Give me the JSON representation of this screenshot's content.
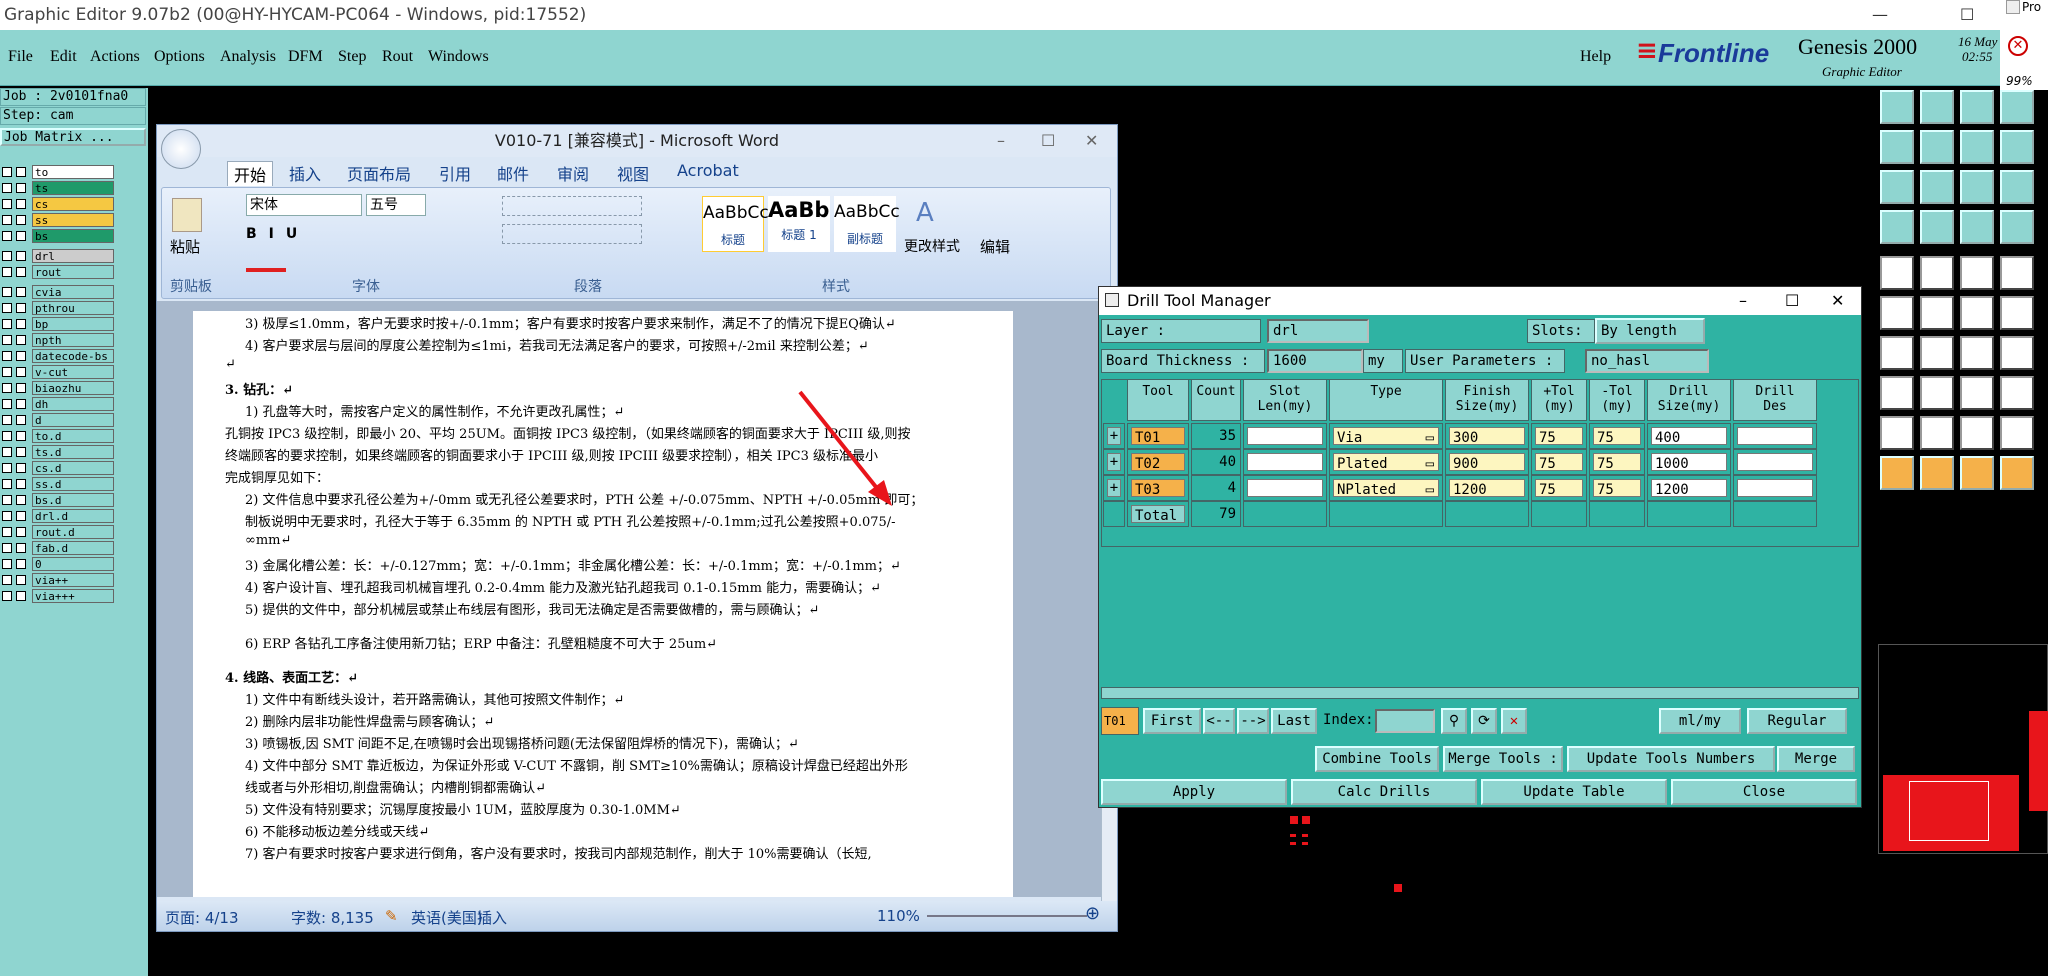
{
  "window": {
    "title": "Graphic Editor 9.07b2 (00@HY-HYCAM-PC064 - Windows, pid:17552)"
  },
  "menu": [
    "File",
    "Edit",
    "Actions",
    "Options",
    "Analysis",
    "DFM",
    "Step",
    "Rout",
    "Windows"
  ],
  "help": "Help",
  "brand": {
    "name": "Frontline",
    "product": "Genesis 2000",
    "sub": "Graphic Editor",
    "date": "16 May",
    "time": "02:55"
  },
  "side_right": {
    "label": "Pro",
    "pct": "99%"
  },
  "job": {
    "job_label": "Job : 2v0101fna0",
    "step_label": "Step: cam",
    "matrix_btn": "Job Matrix ..."
  },
  "layers": [
    {
      "name": "to",
      "color": "#ffffff"
    },
    {
      "name": "ts",
      "color": "#1f9a6a"
    },
    {
      "name": "cs",
      "color": "#f5c842"
    },
    {
      "name": "ss",
      "color": "#f5c842"
    },
    {
      "name": "bs",
      "color": "#1f9a6a"
    },
    {
      "name": "drl",
      "color": "#cccccc"
    },
    {
      "name": "rout",
      "color": "#8fd5d0"
    },
    {
      "name": "cvia",
      "color": "#8fd5d0"
    },
    {
      "name": "pthrou",
      "color": "#8fd5d0"
    },
    {
      "name": "bp",
      "color": "#8fd5d0"
    },
    {
      "name": "npth",
      "color": "#8fd5d0"
    },
    {
      "name": "datecode-bs",
      "color": "#8fd5d0"
    },
    {
      "name": "v-cut",
      "color": "#8fd5d0"
    },
    {
      "name": "biaozhu",
      "color": "#8fd5d0"
    },
    {
      "name": "dh",
      "color": "#8fd5d0"
    },
    {
      "name": "d",
      "color": "#8fd5d0"
    },
    {
      "name": "to.d",
      "color": "#8fd5d0"
    },
    {
      "name": "ts.d",
      "color": "#8fd5d0"
    },
    {
      "name": "cs.d",
      "color": "#8fd5d0"
    },
    {
      "name": "ss.d",
      "color": "#8fd5d0"
    },
    {
      "name": "bs.d",
      "color": "#8fd5d0"
    },
    {
      "name": "drl.d",
      "color": "#8fd5d0"
    },
    {
      "name": "rout.d",
      "color": "#8fd5d0"
    },
    {
      "name": "fab.d",
      "color": "#8fd5d0"
    },
    {
      "name": "0",
      "color": "#8fd5d0"
    },
    {
      "name": "via++",
      "color": "#8fd5d0"
    },
    {
      "name": "via+++",
      "color": "#8fd5d0"
    }
  ],
  "word": {
    "title": "V010-71 [兼容模式] - Microsoft Word",
    "tabs": [
      "开始",
      "插入",
      "页面布局",
      "引用",
      "邮件",
      "审阅",
      "视图",
      "Acrobat"
    ],
    "font": "宋体",
    "size": "五号",
    "styles": [
      "AaBbCc",
      "AaBb(",
      "AaBbCc"
    ],
    "style_names": [
      "标题",
      "标题 1",
      "副标题"
    ],
    "change_style": "更改样式",
    "edit": "编辑",
    "paste": "粘贴",
    "groups": [
      "剪贴板",
      "字体",
      "段落",
      "样式"
    ],
    "status": {
      "page": "页面: 4/13",
      "words": "字数: 8,135",
      "lang": "英语(美国)",
      "mode": "插入",
      "zoom": "110%"
    },
    "lines": [
      "3)  极厚≤1.0mm，客户无要求时按+/-0.1mm；客户有要求时按客户要求来制作，满足不了的情况下提EQ确认↵",
      "4)  客户要求层与层间的厚度公差控制为≤1mi，若我司无法满足客户的要求，可按照+/-2mil 来控制公差；↵",
      "↵",
      "3.   钻孔：↵",
      "1)  孔盘等大时，需按客户定义的属性制作，不允许更改孔属性；↵",
      "孔铜按 IPC3 级控制，即最小 20、平均 25UM。面铜按 IPC3 级控制，（如果终端顾客的铜面要求大于 IPCIII 级,则按",
      "终端顾客的要求控制，如果终端顾客的铜面要求小于 IPCIII 级,则按 IPCIII 级要求控制），相关 IPC3 级标准最小",
      "完成铜厚见如下：",
      "2)  文件信息中要求孔径公差为+/-0mm 或无孔径公差要求时，PTH 公差  +/-0.075mm、NPTH +/-0.05mm 即可；",
      "      制板说明中无要求时，孔径大于等于 6.35mm 的 NPTH 或 PTH 孔公差按照+/-0.1mm;过孔公差按照+0.075/-",
      "      ∞mm↵",
      "3)  金属化槽公差：长：+/-0.127mm；宽：+/-0.1mm；非金属化槽公差：长：+/-0.1mm；宽：+/-0.1mm；↵",
      "4)  客户设计盲、埋孔超我司机械盲埋孔 0.2-0.4mm 能力及激光钻孔超我司 0.1-0.15mm 能力，需要确认；↵",
      "5)  提供的文件中，部分机械层或禁止布线层有图形，我司无法确定是否需要做槽的，需与顾确认；↵",
      "",
      "6)  ERP 各钻孔工序备注使用新刀钻；ERP 中备注：孔壁粗糙度不可大于 25um↵",
      "",
      "4.   线路、表面工艺：↵",
      "1)  文件中有断线头设计，若开路需确认，其他可按照文件制作；↵",
      "2)  删除内层非功能性焊盘需与顾客确认；↵",
      "3)  喷锡板,因 SMT 间距不足,在喷锡时会出现锡搭桥问题(无法保留阻焊桥的情况下)，需确认；↵",
      "4)  文件中部分 SMT 靠近板边，为保证外形或 V-CUT 不露铜，削 SMT≥10%需确认；原稿设计焊盘已经超出外形",
      "      线或者与外形相切,削盘需确认；内槽削铜都需确认↵",
      "5)  文件没有特别要求；沉锡厚度按最小 1UM，蓝胶厚度为 0.30-1.0MM↵",
      "6)  不能移动板边差分线或天线↵",
      "7)  客户有要求时按客户要求进行倒角，客户没有要求时，按我司内部规范制作，削大于 10%需要确认（长短,"
    ]
  },
  "dtm": {
    "title": "Drill Tool Manager",
    "layer_label": "Layer          :",
    "layer_value": "drl",
    "slots_label": "Slots:",
    "slots_value": "By length",
    "board_label": "Board Thickness :",
    "board_value": "1600",
    "board_unit": "my",
    "user_label": "User Parameters :",
    "user_value": "no_hasl",
    "headers": [
      "Tool",
      "Count",
      "Slot\nLen(my)",
      "Type",
      "Finish\nSize(my)",
      "+Tol\n(my)",
      "-Tol\n(my)",
      "Drill\nSize(my)",
      "Drill\nDes"
    ],
    "rows": [
      {
        "tool": "T01",
        "count": "35",
        "type": "Via",
        "finish": "300",
        "ptol": "75",
        "ntol": "75",
        "drill": "400"
      },
      {
        "tool": "T02",
        "count": "40",
        "type": "Plated",
        "finish": "900",
        "ptol": "75",
        "ntol": "75",
        "drill": "1000"
      },
      {
        "tool": "T03",
        "count": "4",
        "type": "NPlated",
        "finish": "1200",
        "ptol": "75",
        "ntol": "75",
        "drill": "1200"
      }
    ],
    "total_label": "Total",
    "total_count": "79",
    "nav": {
      "current": "T01",
      "first": "First",
      "prev": "<--",
      "next": "-->",
      "last": "Last",
      "index": "Index:",
      "units": "ml/my",
      "mode": "Regular"
    },
    "buttons": {
      "combine": "Combine Tools",
      "merge_tools": "Merge Tools :",
      "update_numbers": "Update Tools Numbers",
      "merge": "Merge",
      "apply": "Apply",
      "calc": "Calc Drills",
      "update_table": "Update Table",
      "close": "Close"
    }
  },
  "colors": {
    "teal": "#8fd5d0",
    "dtm_bg": "#2fb3a3",
    "annotation": "#e8151b"
  }
}
